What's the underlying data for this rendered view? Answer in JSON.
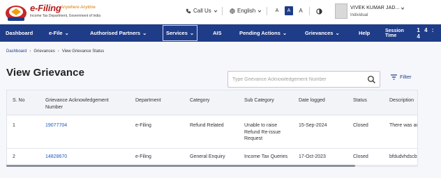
{
  "header": {
    "logo_title": "e-Filing",
    "logo_tagline": "Anywhere Anytime",
    "logo_subtitle": "Income Tax Department, Government of India",
    "call_us": "Call Us",
    "language": "English",
    "font_small": "A",
    "font_normal": "A",
    "font_large": "A",
    "user_name": "VIVEK KUMAR JAD...",
    "user_role": "Individual"
  },
  "nav": {
    "items": [
      {
        "label": "Dashboard"
      },
      {
        "label": "e-File"
      },
      {
        "label": "Authorised Partners"
      },
      {
        "label": "Services"
      },
      {
        "label": "AIS"
      },
      {
        "label": "Pending Actions"
      },
      {
        "label": "Grievances"
      },
      {
        "label": "Help"
      }
    ],
    "session_label": "Session Time",
    "session_digits": "1 4 : 4"
  },
  "breadcrumb": [
    "Dashboard",
    "Grievances",
    "View Grievance Status"
  ],
  "page_title": "View Grievance",
  "search": {
    "placeholder": "Type Grievance Acknowledgement Number"
  },
  "filter_label": "Filter",
  "table": {
    "columns": [
      "S. No",
      "Grievance Acknowledgement Number",
      "Department",
      "Category",
      "Sub Category",
      "Date logged",
      "Status",
      "Description"
    ],
    "rows": [
      {
        "sno": "1",
        "ack": "19077704",
        "department": "e-Filing",
        "category": "Refund Related",
        "sub_category": "Unable to raise Refund Re-issue Request",
        "date": "15-Sep-2024",
        "status": "Closed",
        "description": "There was an"
      },
      {
        "sno": "2",
        "ack": "14828670",
        "department": "e-Filing",
        "category": "General Enquiry",
        "sub_category": "Income Tax Queries",
        "date": "17-Oct-2023",
        "status": "Closed",
        "description": "bfdudvhdscbv"
      }
    ]
  },
  "colors": {
    "nav": "#1f3c88",
    "link": "#1a56c4",
    "brand_red": "#b71c1c"
  }
}
